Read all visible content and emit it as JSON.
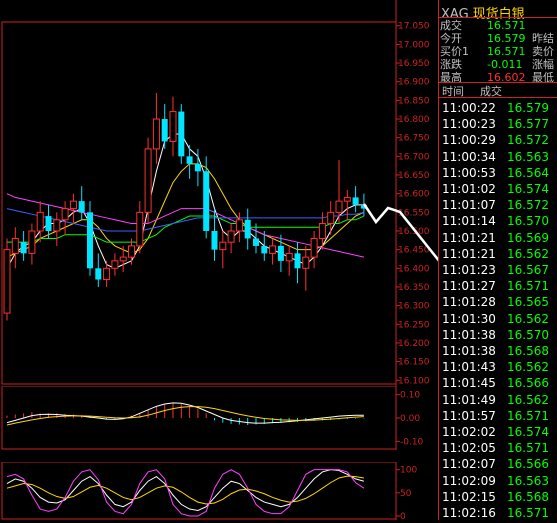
{
  "symbol": "XAG",
  "name": "现货白银",
  "colors": {
    "up": "#ff3030",
    "down": "#00e5ff",
    "axis": "#cc2222",
    "green": "#00ff00",
    "yellow": "#ffd700",
    "white": "#ffffff",
    "magenta": "#ff40ff",
    "blue": "#4060ff"
  },
  "quote": [
    {
      "label": "成交",
      "value": "16.571",
      "color": "#00ff00",
      "extra": ""
    },
    {
      "label": "今开",
      "value": "16.579",
      "color": "#00ff00",
      "extra": "昨结"
    },
    {
      "label": "买价1",
      "value": "16.571",
      "color": "#00ff00",
      "extra": "卖价"
    },
    {
      "label": "涨跌",
      "value": "-0.011",
      "color": "#00ff00",
      "extra": "涨幅"
    },
    {
      "label": "最高",
      "value": "16.602",
      "color": "#ff3030",
      "extra": "最低"
    }
  ],
  "trades_header": {
    "time": "时间",
    "price": "成交"
  },
  "trades": [
    {
      "time": "11:00:22",
      "price": "16.579"
    },
    {
      "time": "11:00:23",
      "price": "16.577"
    },
    {
      "time": "11:00:29",
      "price": "16.572"
    },
    {
      "time": "11:00:34",
      "price": "16.563"
    },
    {
      "time": "11:00:53",
      "price": "16.564"
    },
    {
      "time": "11:01:02",
      "price": "16.574"
    },
    {
      "time": "11:01:07",
      "price": "16.572"
    },
    {
      "time": "11:01:14",
      "price": "16.570"
    },
    {
      "time": "11:01:21",
      "price": "16.569"
    },
    {
      "time": "11:01:21",
      "price": "16.562"
    },
    {
      "time": "11:01:23",
      "price": "16.567"
    },
    {
      "time": "11:01:27",
      "price": "16.571"
    },
    {
      "time": "11:01:28",
      "price": "16.565"
    },
    {
      "time": "11:01:30",
      "price": "16.562"
    },
    {
      "time": "11:01:38",
      "price": "16.570"
    },
    {
      "time": "11:01:38",
      "price": "16.568"
    },
    {
      "time": "11:01:43",
      "price": "16.562"
    },
    {
      "time": "11:01:45",
      "price": "16.566"
    },
    {
      "time": "11:01:49",
      "price": "16.562"
    },
    {
      "time": "11:01:57",
      "price": "16.571"
    },
    {
      "time": "11:02:02",
      "price": "16.574"
    },
    {
      "time": "11:02:05",
      "price": "16.571"
    },
    {
      "time": "11:02:07",
      "price": "16.566"
    },
    {
      "time": "11:02:09",
      "price": "16.563"
    },
    {
      "time": "11:02:15",
      "price": "16.568"
    },
    {
      "time": "11:02:16",
      "price": "16.571"
    }
  ],
  "price_axis": [
    "17.050",
    "17.000",
    "16.950",
    "16.900",
    "16.850",
    "16.800",
    "16.750",
    "16.700",
    "16.650",
    "16.600",
    "16.550",
    "16.500",
    "16.450",
    "16.400",
    "16.350",
    "16.300",
    "16.250",
    "16.200",
    "16.150",
    "16.100"
  ],
  "macd_axis": [
    "0.10",
    "0.00",
    "-0.10"
  ],
  "kdj_axis": [
    "100",
    "50",
    "0"
  ],
  "chart_data": {
    "type": "candlestick",
    "price_range": [
      16.09,
      17.06
    ],
    "candles": [
      {
        "o": 16.28,
        "h": 16.48,
        "l": 16.26,
        "c": 16.45
      },
      {
        "o": 16.44,
        "h": 16.51,
        "l": 16.4,
        "c": 16.48
      },
      {
        "o": 16.47,
        "h": 16.5,
        "l": 16.42,
        "c": 16.44
      },
      {
        "o": 16.44,
        "h": 16.52,
        "l": 16.41,
        "c": 16.5
      },
      {
        "o": 16.5,
        "h": 16.58,
        "l": 16.47,
        "c": 16.55
      },
      {
        "o": 16.54,
        "h": 16.57,
        "l": 16.48,
        "c": 16.5
      },
      {
        "o": 16.5,
        "h": 16.55,
        "l": 16.46,
        "c": 16.53
      },
      {
        "o": 16.53,
        "h": 16.58,
        "l": 16.49,
        "c": 16.56
      },
      {
        "o": 16.56,
        "h": 16.6,
        "l": 16.52,
        "c": 16.58
      },
      {
        "o": 16.58,
        "h": 16.62,
        "l": 16.53,
        "c": 16.55
      },
      {
        "o": 16.55,
        "h": 16.58,
        "l": 16.38,
        "c": 16.4
      },
      {
        "o": 16.4,
        "h": 16.44,
        "l": 16.35,
        "c": 16.37
      },
      {
        "o": 16.37,
        "h": 16.42,
        "l": 16.35,
        "c": 16.4
      },
      {
        "o": 16.4,
        "h": 16.44,
        "l": 16.38,
        "c": 16.42
      },
      {
        "o": 16.42,
        "h": 16.46,
        "l": 16.39,
        "c": 16.43
      },
      {
        "o": 16.43,
        "h": 16.48,
        "l": 16.41,
        "c": 16.46
      },
      {
        "o": 16.46,
        "h": 16.58,
        "l": 16.44,
        "c": 16.55
      },
      {
        "o": 16.55,
        "h": 16.75,
        "l": 16.52,
        "c": 16.72
      },
      {
        "o": 16.72,
        "h": 16.87,
        "l": 16.68,
        "c": 16.8
      },
      {
        "o": 16.8,
        "h": 16.84,
        "l": 16.72,
        "c": 16.74
      },
      {
        "o": 16.74,
        "h": 16.86,
        "l": 16.7,
        "c": 16.82
      },
      {
        "o": 16.82,
        "h": 16.84,
        "l": 16.68,
        "c": 16.7
      },
      {
        "o": 16.7,
        "h": 16.73,
        "l": 16.64,
        "c": 16.68
      },
      {
        "o": 16.68,
        "h": 16.72,
        "l": 16.62,
        "c": 16.66
      },
      {
        "o": 16.66,
        "h": 16.7,
        "l": 16.48,
        "c": 16.5
      },
      {
        "o": 16.5,
        "h": 16.56,
        "l": 16.42,
        "c": 16.45
      },
      {
        "o": 16.45,
        "h": 16.5,
        "l": 16.4,
        "c": 16.47
      },
      {
        "o": 16.47,
        "h": 16.52,
        "l": 16.44,
        "c": 16.5
      },
      {
        "o": 16.5,
        "h": 16.55,
        "l": 16.47,
        "c": 16.53
      },
      {
        "o": 16.53,
        "h": 16.56,
        "l": 16.45,
        "c": 16.48
      },
      {
        "o": 16.48,
        "h": 16.52,
        "l": 16.44,
        "c": 16.46
      },
      {
        "o": 16.46,
        "h": 16.5,
        "l": 16.42,
        "c": 16.44
      },
      {
        "o": 16.44,
        "h": 16.48,
        "l": 16.41,
        "c": 16.46
      },
      {
        "o": 16.46,
        "h": 16.49,
        "l": 16.39,
        "c": 16.42
      },
      {
        "o": 16.42,
        "h": 16.46,
        "l": 16.38,
        "c": 16.44
      },
      {
        "o": 16.44,
        "h": 16.47,
        "l": 16.36,
        "c": 16.4
      },
      {
        "o": 16.4,
        "h": 16.46,
        "l": 16.34,
        "c": 16.43
      },
      {
        "o": 16.43,
        "h": 16.5,
        "l": 16.4,
        "c": 16.48
      },
      {
        "o": 16.48,
        "h": 16.55,
        "l": 16.45,
        "c": 16.52
      },
      {
        "o": 16.52,
        "h": 16.58,
        "l": 16.49,
        "c": 16.55
      },
      {
        "o": 16.55,
        "h": 16.69,
        "l": 16.52,
        "c": 16.58
      },
      {
        "o": 16.58,
        "h": 16.61,
        "l": 16.53,
        "c": 16.59
      },
      {
        "o": 16.59,
        "h": 16.62,
        "l": 16.55,
        "c": 16.57
      },
      {
        "o": 16.57,
        "h": 16.6,
        "l": 16.54,
        "c": 16.56
      }
    ],
    "lines": [
      {
        "color": "#ffffff",
        "values": [
          16.4,
          16.44,
          16.46,
          16.47,
          16.5,
          16.52,
          16.52,
          16.53,
          16.55,
          16.56,
          16.52,
          16.46,
          16.41,
          16.4,
          16.41,
          16.42,
          16.46,
          16.56,
          16.66,
          16.74,
          16.76,
          16.76,
          16.72,
          16.7,
          16.64,
          16.56,
          16.5,
          16.48,
          16.5,
          16.5,
          16.48,
          16.46,
          16.45,
          16.44,
          16.43,
          16.42,
          16.41,
          16.43,
          16.46,
          16.5,
          16.54,
          16.56,
          16.57,
          16.57
        ]
      },
      {
        "color": "#ffd700",
        "values": [
          16.43,
          16.44,
          16.45,
          16.46,
          16.48,
          16.49,
          16.5,
          16.51,
          16.52,
          16.53,
          16.53,
          16.51,
          16.48,
          16.46,
          16.45,
          16.44,
          16.45,
          16.48,
          16.53,
          16.58,
          16.63,
          16.66,
          16.68,
          16.68,
          16.67,
          16.64,
          16.6,
          16.56,
          16.53,
          16.51,
          16.5,
          16.49,
          16.48,
          16.47,
          16.46,
          16.45,
          16.45,
          16.45,
          16.46,
          16.48,
          16.5,
          16.52,
          16.54,
          16.55
        ]
      },
      {
        "color": "#ff40ff",
        "values": [
          16.6,
          16.59,
          16.585,
          16.58,
          16.575,
          16.57,
          16.565,
          16.56,
          16.555,
          16.55,
          16.545,
          16.54,
          16.535,
          16.53,
          16.525,
          16.52,
          16.52,
          16.52,
          16.53,
          16.54,
          16.55,
          16.56,
          16.56,
          16.56,
          16.56,
          16.55,
          16.54,
          16.53,
          16.52,
          16.51,
          16.5,
          16.49,
          16.485,
          16.48,
          16.475,
          16.47,
          16.465,
          16.46,
          16.455,
          16.45,
          16.445,
          16.44,
          16.435,
          16.43
        ]
      },
      {
        "color": "#00ff00",
        "values": [
          16.47,
          16.47,
          16.47,
          16.47,
          16.48,
          16.48,
          16.48,
          16.49,
          16.49,
          16.49,
          16.49,
          16.48,
          16.47,
          16.47,
          16.47,
          16.47,
          16.47,
          16.48,
          16.49,
          16.51,
          16.52,
          16.53,
          16.54,
          16.54,
          16.54,
          16.54,
          16.53,
          16.52,
          16.52,
          16.51,
          16.51,
          16.51,
          16.51,
          16.51,
          16.51,
          16.51,
          16.51,
          16.51,
          16.51,
          16.52,
          16.52,
          16.53,
          16.53,
          16.54
        ]
      },
      {
        "color": "#4060ff",
        "values": [
          16.56,
          16.555,
          16.55,
          16.545,
          16.54,
          16.535,
          16.53,
          16.525,
          16.52,
          16.515,
          16.51,
          16.505,
          16.5,
          16.5,
          16.5,
          16.5,
          16.5,
          16.505,
          16.51,
          16.515,
          16.52,
          16.525,
          16.53,
          16.535,
          16.535,
          16.535,
          16.535,
          16.535,
          16.535,
          16.535,
          16.535,
          16.535,
          16.535,
          16.535,
          16.535,
          16.535,
          16.535,
          16.535,
          16.535,
          16.54,
          16.54,
          16.545,
          16.545,
          16.55
        ]
      }
    ],
    "macd": {
      "range": [
        -0.12,
        0.12
      ],
      "hist": [
        0.01,
        0.015,
        0.02,
        0.025,
        0.02,
        0.02,
        0.02,
        0.018,
        0.015,
        0.012,
        0.005,
        0.0,
        -0.005,
        -0.005,
        0.0,
        0.01,
        0.02,
        0.035,
        0.05,
        0.06,
        0.065,
        0.06,
        0.05,
        0.04,
        0.02,
        -0.01,
        -0.02,
        -0.025,
        -0.028,
        -0.03,
        -0.028,
        -0.025,
        -0.022,
        -0.02,
        -0.018,
        -0.016,
        -0.014,
        -0.012,
        -0.01,
        -0.008,
        -0.006,
        -0.004,
        -0.003,
        -0.002
      ],
      "dif": [
        -0.02,
        -0.01,
        0.0,
        0.01,
        0.015,
        0.016,
        0.015,
        0.012,
        0.01,
        0.008,
        0.004,
        0.0,
        -0.005,
        -0.006,
        -0.003,
        0.005,
        0.02,
        0.035,
        0.05,
        0.06,
        0.065,
        0.063,
        0.055,
        0.045,
        0.03,
        0.015,
        0.0,
        -0.01,
        -0.015,
        -0.02,
        -0.022,
        -0.022,
        -0.02,
        -0.018,
        -0.015,
        -0.012,
        -0.008,
        -0.004,
        0.0,
        0.004,
        0.008,
        0.01,
        0.012,
        0.012
      ],
      "dea": [
        -0.03,
        -0.022,
        -0.015,
        -0.008,
        -0.002,
        0.003,
        0.006,
        0.008,
        0.009,
        0.009,
        0.008,
        0.006,
        0.003,
        0.001,
        0.0,
        0.001,
        0.005,
        0.012,
        0.022,
        0.032,
        0.04,
        0.046,
        0.049,
        0.049,
        0.046,
        0.04,
        0.032,
        0.024,
        0.016,
        0.009,
        0.003,
        -0.002,
        -0.005,
        -0.008,
        -0.009,
        -0.01,
        -0.01,
        -0.009,
        -0.007,
        -0.005,
        -0.002,
        0.001,
        0.004,
        0.006
      ]
    },
    "kdj": {
      "range": [
        0,
        110
      ],
      "k": [
        70,
        80,
        75,
        60,
        40,
        30,
        28,
        35,
        55,
        75,
        85,
        70,
        45,
        25,
        20,
        30,
        55,
        75,
        85,
        70,
        45,
        25,
        15,
        12,
        20,
        40,
        60,
        75,
        70,
        55,
        40,
        30,
        25,
        20,
        25,
        40,
        60,
        80,
        95,
        100,
        98,
        90,
        80,
        75
      ],
      "d": [
        60,
        65,
        70,
        68,
        60,
        50,
        42,
        38,
        42,
        52,
        62,
        66,
        60,
        50,
        40,
        35,
        40,
        50,
        60,
        65,
        62,
        52,
        40,
        30,
        26,
        28,
        36,
        48,
        56,
        58,
        54,
        48,
        40,
        34,
        30,
        32,
        38,
        48,
        60,
        72,
        82,
        86,
        85,
        82
      ],
      "j": [
        85,
        90,
        80,
        45,
        15,
        10,
        15,
        40,
        75,
        95,
        100,
        78,
        30,
        10,
        5,
        25,
        70,
        95,
        100,
        80,
        25,
        5,
        0,
        0,
        10,
        60,
        90,
        100,
        90,
        60,
        25,
        10,
        5,
        5,
        20,
        55,
        90,
        100,
        100,
        100,
        100,
        95,
        72,
        60
      ]
    }
  }
}
